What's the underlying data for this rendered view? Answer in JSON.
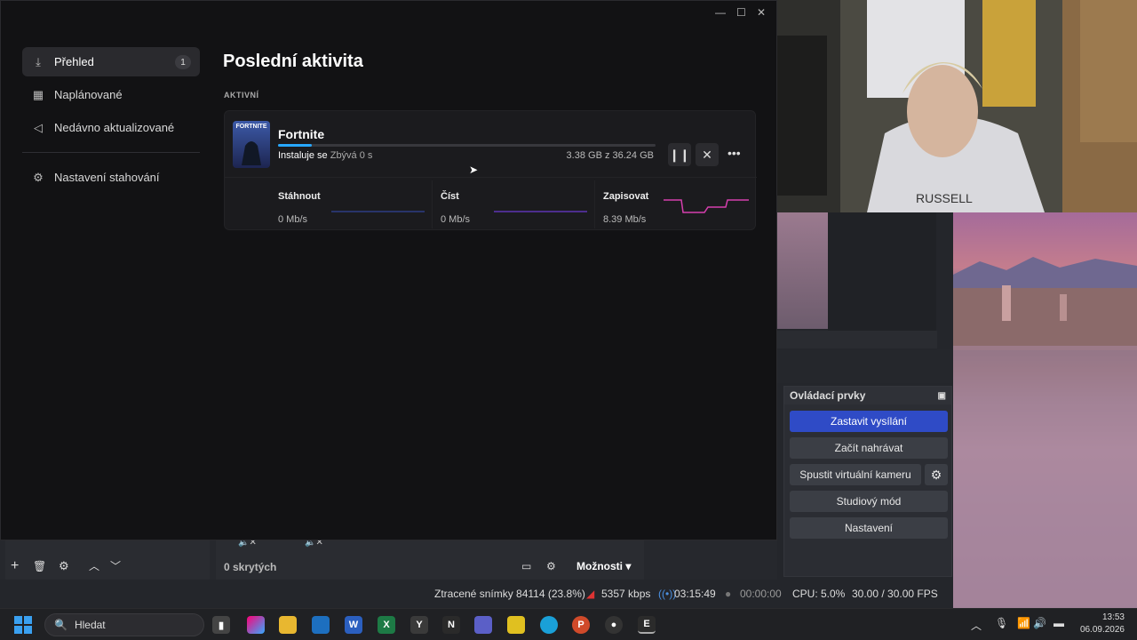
{
  "epic": {
    "nav": [
      {
        "label": "Přehled",
        "badge": "1",
        "icon": "download-icon"
      },
      {
        "label": "Naplánované",
        "icon": "calendar-icon"
      },
      {
        "label": "Nedávno aktualizované",
        "icon": "megaphone-icon"
      },
      {
        "label": "Nastavení stahování",
        "icon": "gear-icon"
      }
    ],
    "page_title": "Poslední aktivita",
    "section_label": "AKTIVNÍ",
    "download": {
      "game": "Fortnite",
      "thumb_text": "FORTNITE",
      "status_label": "Instaluje se",
      "remaining": "Zbývá 0 s",
      "size": "3.38 GB z 36.24 GB",
      "progress": 0.09
    },
    "stats": [
      {
        "title": "Stáhnout",
        "value": "0 Mb/s"
      },
      {
        "title": "Číst",
        "value": "0 Mb/s"
      },
      {
        "title": "Zapisovat",
        "value": "8.39 Mb/s"
      }
    ]
  },
  "obs": {
    "controls_title": "Ovládací prvky",
    "buttons": [
      "Zastavit vysílání",
      "Začít nahrávat",
      "Spustit virtuální kameru",
      "Studiový mód",
      "Nastavení"
    ],
    "hidden_count": "0 skrytých",
    "options_label": "Možnosti",
    "status": {
      "dropped": "Ztracené snímky 84114 (23.8%)",
      "bitrate": "5357 kbps",
      "live_time": "03:15:49",
      "rec_time": "00:00:00",
      "cpu": "CPU: 5.0%",
      "fps": "30.00 / 30.00 FPS"
    }
  },
  "taskbar": {
    "search_placeholder": "Hledat",
    "time": "13:53",
    "date": "06.09.2026"
  },
  "colors": {
    "accent": "#2f4bc6",
    "progress": "#27a8ff",
    "graph_read": "#7b3ff2",
    "graph_write": "#d63fae"
  }
}
